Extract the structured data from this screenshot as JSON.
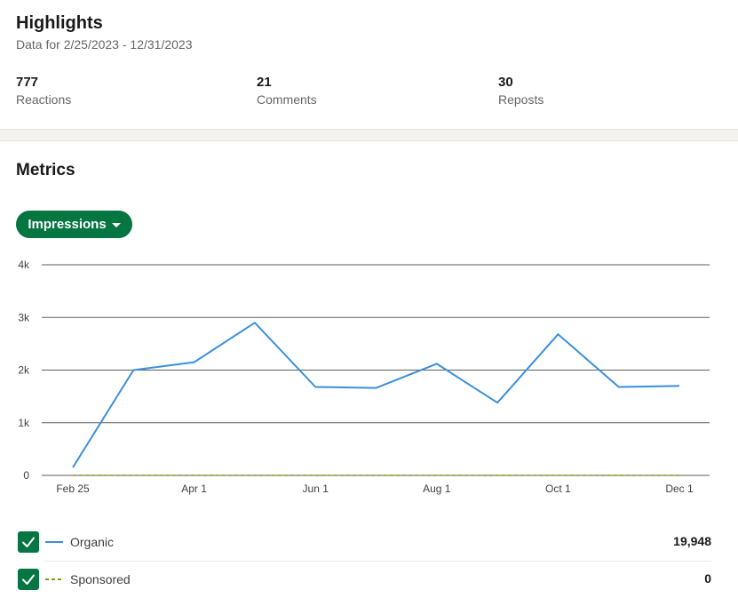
{
  "highlights": {
    "title": "Highlights",
    "subtitle": "Data for 2/25/2023 - 12/31/2023",
    "stats": [
      {
        "value": "777",
        "label": "Reactions"
      },
      {
        "value": "21",
        "label": "Comments"
      },
      {
        "value": "30",
        "label": "Reposts"
      }
    ]
  },
  "metrics": {
    "title": "Metrics",
    "dropdown_label": "Impressions",
    "accent_color": "#057642"
  },
  "legend": [
    {
      "name": "Organic",
      "total": "19,948",
      "checked": true,
      "color": "#3b8fdc",
      "style": "solid"
    },
    {
      "name": "Sponsored",
      "total": "0",
      "checked": true,
      "color": "#7b9a1a",
      "style": "dashed"
    }
  ],
  "chart_data": {
    "type": "line",
    "x_tick_labels": [
      "Feb 25",
      "Apr 1",
      "Jun 1",
      "Aug 1",
      "Oct 1",
      "Dec 1"
    ],
    "y_tick_labels": [
      "0",
      "1k",
      "2k",
      "3k",
      "4k"
    ],
    "ylim": [
      0,
      4000
    ],
    "grid": true,
    "series": [
      {
        "name": "Organic",
        "color": "#3b8fdc",
        "dashed": false,
        "values": [
          150,
          2000,
          2150,
          2900,
          1680,
          1660,
          2120,
          1380,
          2680,
          1680,
          1700
        ]
      },
      {
        "name": "Sponsored",
        "color": "#7b9a1a",
        "dashed": true,
        "values": [
          0,
          0,
          0,
          0,
          0,
          0,
          0,
          0,
          0,
          0,
          0
        ]
      }
    ]
  }
}
